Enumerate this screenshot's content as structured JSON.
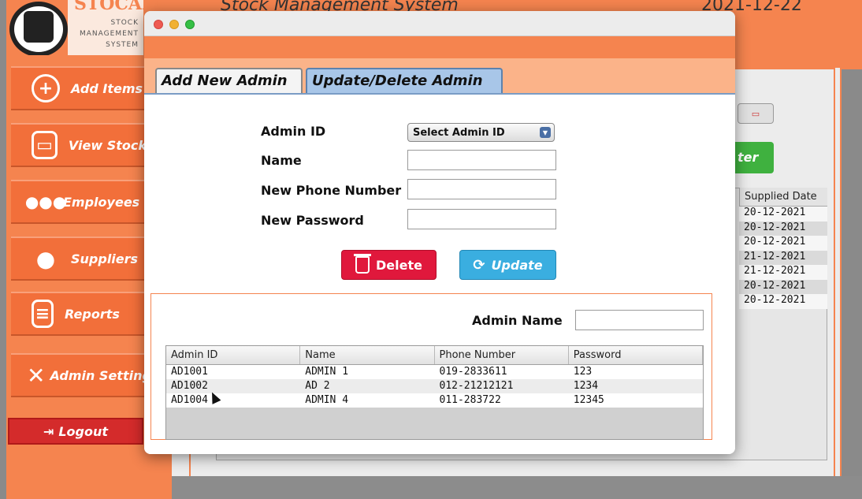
{
  "background_app": {
    "brand": {
      "word": "STOCAPP",
      "line1": "STOCK",
      "line2": "MANAGEMENT",
      "line3": "SYSTEM"
    },
    "header_title": "Stock Management System",
    "header_date": "2021-12-22",
    "sidebar": {
      "items": [
        {
          "label": "Add Items",
          "icon": "plus-circle-icon"
        },
        {
          "label": "View Stock",
          "icon": "box-icon"
        },
        {
          "label": "Employees",
          "icon": "people-icon"
        },
        {
          "label": "Suppliers",
          "icon": "person-icon"
        },
        {
          "label": "Reports",
          "icon": "document-icon"
        },
        {
          "label": "Admin Settings",
          "icon": "tools-icon"
        }
      ],
      "logout_label": "Logout"
    },
    "filter_label": "ter",
    "table": {
      "visible_column": "Supplied Date",
      "values": [
        "20-12-2021",
        "20-12-2021",
        "20-12-2021",
        "21-12-2021",
        "21-12-2021",
        "20-12-2021",
        "20-12-2021"
      ]
    }
  },
  "dialog": {
    "tabs": [
      "Add New Admin",
      "Update/Delete Admin"
    ],
    "active_tab": "Update/Delete Admin",
    "form": {
      "admin_id_label": "Admin ID",
      "admin_id_select": "Select Admin ID",
      "name_label": "Name",
      "phone_label": "New Phone Number",
      "password_label": "New Password",
      "name_value": "",
      "phone_value": "",
      "password_value": ""
    },
    "buttons": {
      "delete": "Delete",
      "update": "Update"
    },
    "search": {
      "label": "Admin Name",
      "value": ""
    },
    "table": {
      "columns": [
        "Admin ID",
        "Name",
        "Phone Number",
        "Password"
      ],
      "rows": [
        [
          "AD1001",
          "ADMIN 1",
          "019-2833611",
          "123"
        ],
        [
          "AD1002",
          "AD 2",
          "012-21212121",
          "1234"
        ],
        [
          "AD1004",
          "ADMIN 4",
          "011-283722",
          "12345"
        ]
      ]
    }
  },
  "colors": {
    "accent_orange": "#f5844f",
    "delete_red": "#e0183c",
    "update_blue": "#3aaee0",
    "active_tab_blue": "#a8c6e8"
  }
}
